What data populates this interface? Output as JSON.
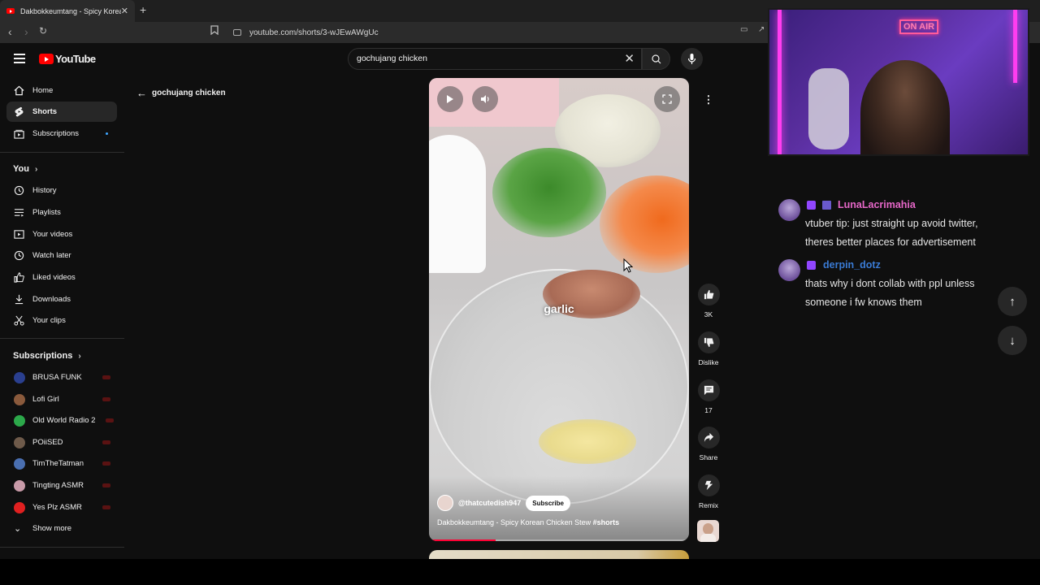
{
  "browser": {
    "tab_title": "Dakbokkeumtang - Spicy Korean",
    "url": "youtube.com/shorts/3-wJEwAWgUc"
  },
  "header": {
    "logo_text": "YouTube",
    "search_value": "gochujang chicken"
  },
  "sidebar": {
    "main": [
      {
        "label": "Home",
        "icon": "home-icon"
      },
      {
        "label": "Shorts",
        "icon": "shorts-icon",
        "active": true
      },
      {
        "label": "Subscriptions",
        "icon": "subscriptions-icon"
      }
    ],
    "you_header": "You",
    "you_items": [
      {
        "label": "History",
        "icon": "history-icon"
      },
      {
        "label": "Playlists",
        "icon": "playlists-icon"
      },
      {
        "label": "Your videos",
        "icon": "your-videos-icon"
      },
      {
        "label": "Watch later",
        "icon": "watch-later-icon"
      },
      {
        "label": "Liked videos",
        "icon": "liked-videos-icon"
      },
      {
        "label": "Downloads",
        "icon": "downloads-icon"
      },
      {
        "label": "Your clips",
        "icon": "clips-icon"
      }
    ],
    "subs_header": "Subscriptions",
    "subscriptions": [
      {
        "label": "BRUSA FUNK",
        "color": "#2a3f8f"
      },
      {
        "label": "Lofi Girl",
        "color": "#8a5a3c"
      },
      {
        "label": "Old World Radio 2",
        "color": "#2ca84a"
      },
      {
        "label": "POiiSED",
        "color": "#6e5a4a"
      },
      {
        "label": "TimTheTatman",
        "color": "#4a6fb0"
      },
      {
        "label": "Tingting ASMR",
        "color": "#c89aa8"
      },
      {
        "label": "Yes Plz ASMR",
        "color": "#e02020"
      }
    ],
    "show_more": "Show more"
  },
  "shorts": {
    "back_label": "gochujang chicken",
    "overlay_text": "garlic",
    "channel": "@thatcutedish947",
    "subscribe_label": "Subscribe",
    "title": "Dakbokkeumtang - Spicy Korean Chicken Stew",
    "hashtag": "#shorts",
    "progress": 0.25,
    "actions": {
      "likes": "3K",
      "dislike": "Dislike",
      "comments": "17",
      "share": "Share",
      "remix": "Remix"
    }
  },
  "webcam": {
    "sign": "ON AIR"
  },
  "chat": [
    {
      "user": "LunaLacrimahia",
      "color": "#e667c8",
      "text": "vtuber tip: just straight up avoid twitter, theres better places for advertisement"
    },
    {
      "user": "derpin_dotz",
      "color": "#3a7bd5",
      "text": "thats why i dont collab with ppl unless someone i fw knows them"
    }
  ]
}
